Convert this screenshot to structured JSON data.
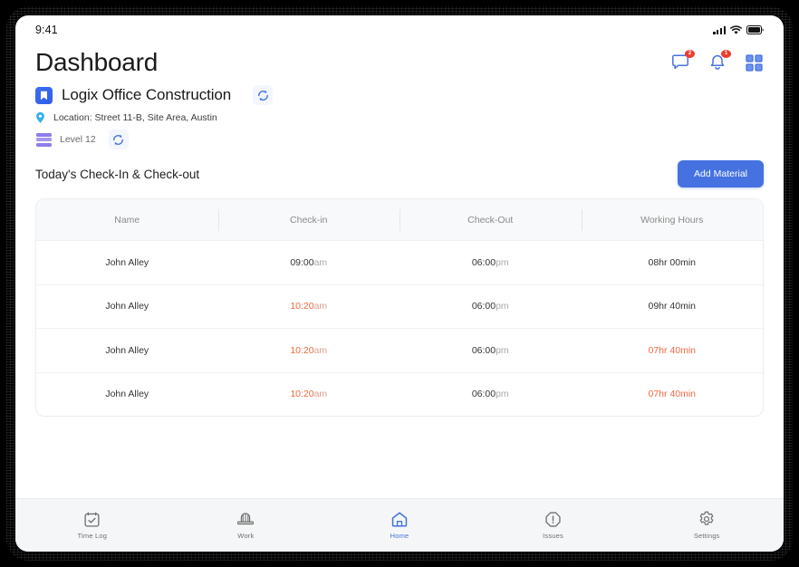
{
  "status_bar": {
    "time": "9:41",
    "icons": [
      "signal-icon",
      "wifi-icon",
      "battery-icon"
    ]
  },
  "header": {
    "title": "Dashboard",
    "actions": [
      {
        "name": "messages-icon",
        "badge": "2"
      },
      {
        "name": "notifications-bell-icon",
        "badge": "1"
      },
      {
        "name": "apps-grid-icon",
        "badge": ""
      }
    ]
  },
  "project": {
    "icon": "bookmark-icon",
    "name": "Logix Office Construction",
    "swap_project_icon": "swap-refresh-icon",
    "location_icon": "location-pin-icon",
    "location": "Location: Street 11-B, Site Area, Austin",
    "level_icon": "layers-icon",
    "level": "Level 12",
    "swap_level_icon": "swap-refresh-icon"
  },
  "section": {
    "title": "Today's Check-In & Check-out",
    "add_material_label": "Add Material"
  },
  "table": {
    "columns": [
      "Name",
      "Check-in",
      "Check-Out",
      "Working Hours"
    ],
    "rows": [
      {
        "name": "John Alley",
        "check_in": "09:00",
        "check_in_suffix": "am",
        "check_in_late": false,
        "check_out": "06:00",
        "check_out_suffix": "pm",
        "working_hours": "08hr 00min",
        "hours_alert": false
      },
      {
        "name": "John Alley",
        "check_in": "10:20",
        "check_in_suffix": "am",
        "check_in_late": true,
        "check_out": "06:00",
        "check_out_suffix": "pm",
        "working_hours": "09hr 40min",
        "hours_alert": false
      },
      {
        "name": "John Alley",
        "check_in": "10:20",
        "check_in_suffix": "am",
        "check_in_late": true,
        "check_out": "06:00",
        "check_out_suffix": "pm",
        "working_hours": "07hr 40min",
        "hours_alert": true
      },
      {
        "name": "John Alley",
        "check_in": "10:20",
        "check_in_suffix": "am",
        "check_in_late": true,
        "check_out": "06:00",
        "check_out_suffix": "pm",
        "working_hours": "07hr 40min",
        "hours_alert": true
      }
    ]
  },
  "bottom_nav": {
    "items": [
      {
        "label": "Time Log",
        "icon": "calendar-check-icon",
        "active": false
      },
      {
        "label": "Work",
        "icon": "hard-hat-icon",
        "active": false
      },
      {
        "label": "Home",
        "icon": "home-icon",
        "active": true
      },
      {
        "label": "Issues",
        "icon": "alert-octagon-icon",
        "active": false
      },
      {
        "label": "Settings",
        "icon": "gear-icon",
        "active": false
      }
    ]
  },
  "colors": {
    "accent_blue": "#4572e0",
    "alert_orange": "#f2683f",
    "badge_red": "#ef3b2d",
    "level_purple": "#8f7ce8",
    "pin_blue": "#2fb2e8"
  }
}
